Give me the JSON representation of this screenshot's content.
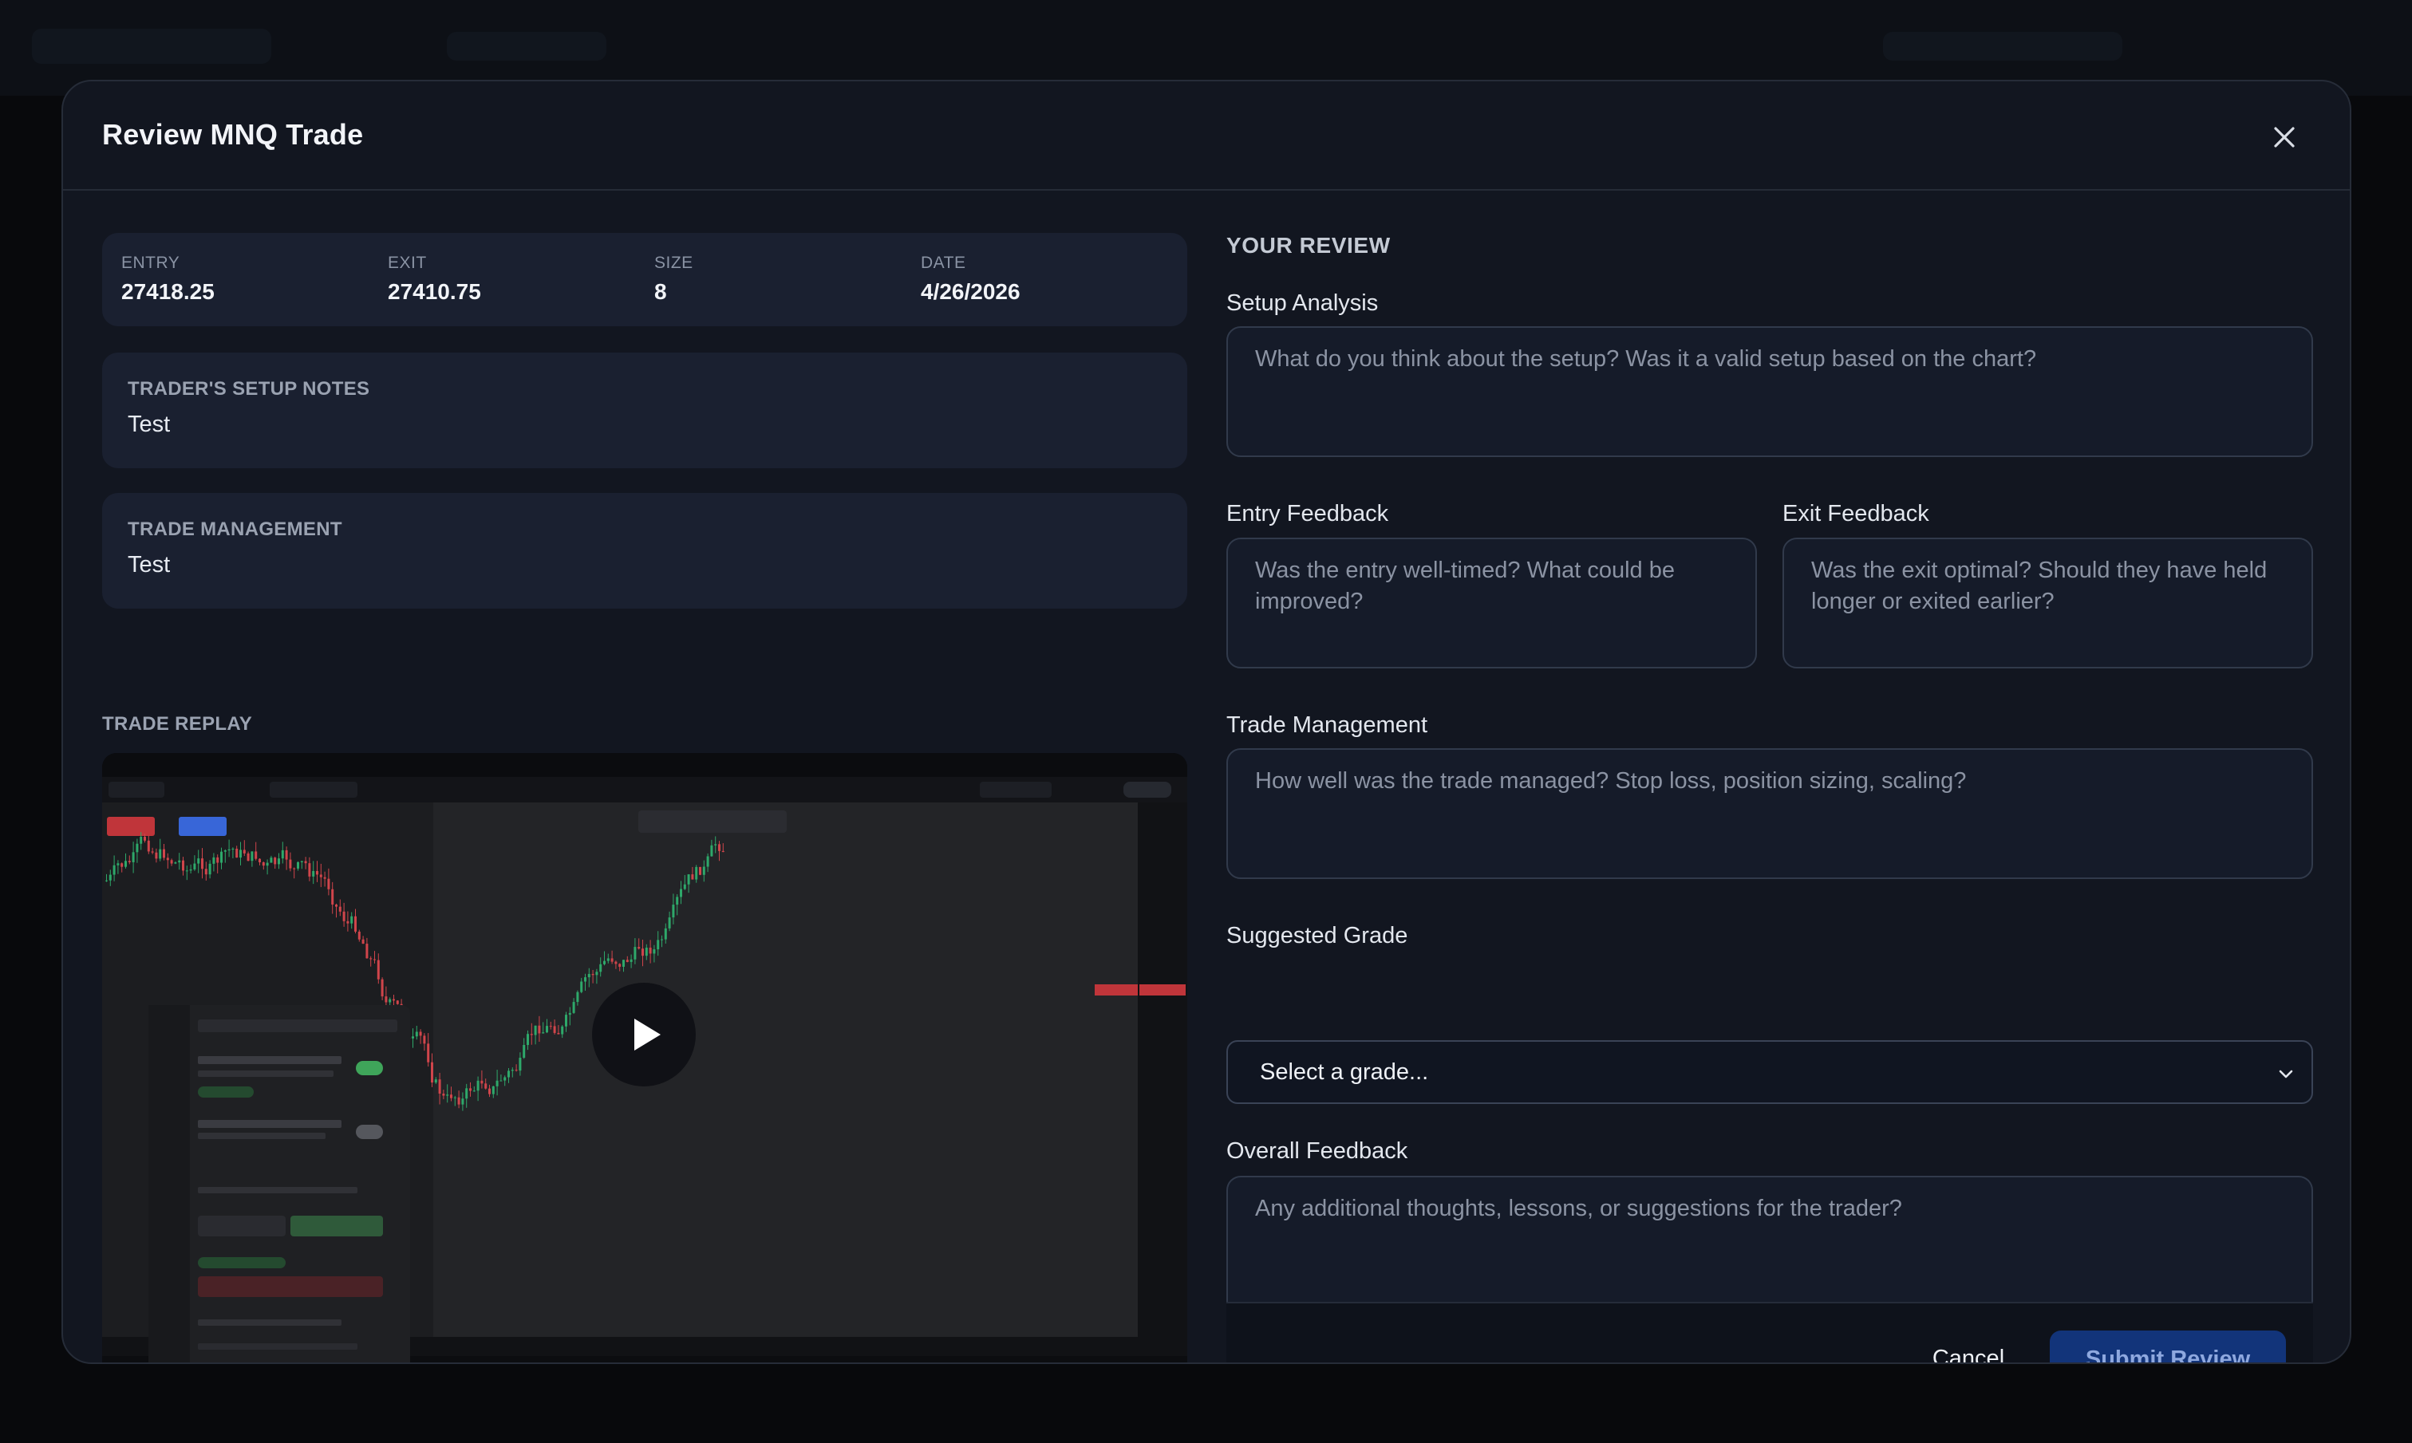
{
  "modal": {
    "title": "Review MNQ Trade"
  },
  "summary": {
    "entry_label": "ENTRY",
    "entry_value": "27418.25",
    "exit_label": "EXIT",
    "exit_value": "27410.75",
    "size_label": "SIZE",
    "size_value": "8",
    "date_label": "DATE",
    "date_value": "4/26/2026"
  },
  "setup_notes": {
    "label": "TRADER'S SETUP NOTES",
    "value": "Test"
  },
  "trade_management_notes": {
    "label": "TRADE MANAGEMENT",
    "value": "Test"
  },
  "replay": {
    "label": "TRADE REPLAY"
  },
  "review": {
    "title": "YOUR REVIEW",
    "setup_analysis": {
      "label": "Setup Analysis",
      "placeholder": "What do you think about the setup? Was it a valid setup based on the chart?"
    },
    "entry_feedback": {
      "label": "Entry Feedback",
      "placeholder": "Was the entry well-timed? What could be improved?"
    },
    "exit_feedback": {
      "label": "Exit Feedback",
      "placeholder": "Was the exit optimal? Should they have held longer or exited earlier?"
    },
    "trade_management": {
      "label": "Trade Management",
      "placeholder": "How well was the trade managed? Stop loss, position sizing, scaling?"
    },
    "suggested_grade": {
      "label": "Suggested Grade",
      "selected": "Select a grade..."
    },
    "overall_feedback": {
      "label": "Overall Feedback",
      "placeholder": "Any additional thoughts, lessons, or suggestions for the trader?"
    }
  },
  "footer": {
    "cancel_label": "Cancel",
    "submit_label": "Submit Review"
  },
  "icons": {
    "close": "close-icon",
    "play": "play-icon",
    "chevron": "chevron-down-icon"
  }
}
